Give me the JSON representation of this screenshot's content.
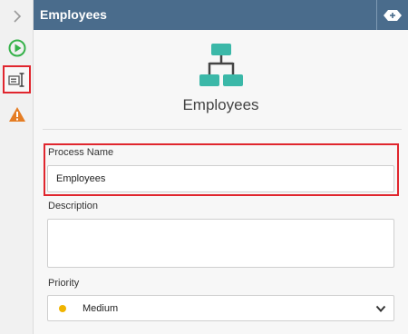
{
  "header": {
    "title": "Employees"
  },
  "process": {
    "title": "Employees"
  },
  "fields": {
    "process_name": {
      "label": "Process Name",
      "value": "Employees"
    },
    "description": {
      "label": "Description",
      "value": ""
    },
    "priority": {
      "label": "Priority",
      "value": "Medium",
      "dot_color": "#f0b400"
    }
  },
  "icons": {
    "rail": [
      "chevron-right-icon",
      "run-icon",
      "properties-icon",
      "warning-icon"
    ],
    "header": "collapse-panel-icon",
    "process": "hierarchy-icon"
  },
  "colors": {
    "header_bg": "#4a6c8c",
    "accent_teal": "#3bb8a8",
    "run_green": "#36b24a",
    "warning_orange": "#e57d24",
    "highlight_red": "#e0262e"
  }
}
